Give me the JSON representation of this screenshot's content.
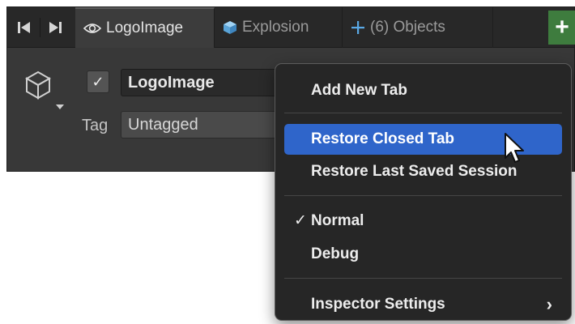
{
  "window": {
    "nav": {
      "prev_icon": "step-back-icon",
      "next_icon": "step-forward-icon"
    },
    "tabs": [
      {
        "label": "LogoImage",
        "icon": "eye-icon",
        "active": true
      },
      {
        "label": "Explosion",
        "icon": "prefab-cube-icon",
        "icon_color": "#6fb3e8",
        "active": false
      },
      {
        "label": "(6) Objects",
        "icon": "plus-icon",
        "icon_color": "#5aa9e6",
        "active": false
      }
    ],
    "add_tab_button": {
      "label": "+",
      "color": "#3e7c3e"
    }
  },
  "inspector": {
    "game_object_icon": "cube-outline-icon",
    "active_checkbox": {
      "checked": true,
      "glyph": "✓"
    },
    "name": "LogoImage",
    "tag_label": "Tag",
    "tag_value": "Untagged"
  },
  "context_menu": {
    "items": [
      {
        "label": "Add New Tab"
      },
      {
        "label": "Restore Closed Tab",
        "highlighted": true,
        "highlight_color": "#2f65ca"
      },
      {
        "label": "Restore Last Saved Session"
      },
      {
        "label": "Normal",
        "checked": true,
        "check_glyph": "✓"
      },
      {
        "label": "Debug"
      },
      {
        "label": "Inspector Settings",
        "submenu_glyph": "›"
      }
    ]
  }
}
